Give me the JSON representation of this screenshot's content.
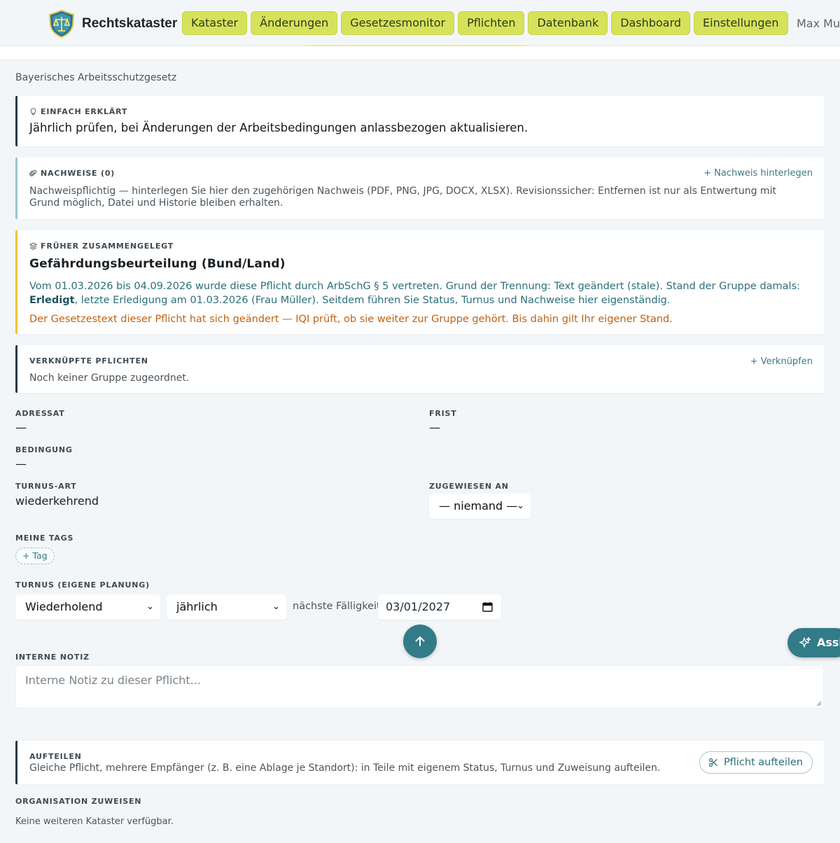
{
  "app": {
    "name": "Rechtskataster",
    "nav": [
      "Kataster",
      "Änderungen",
      "Gesetzesmonitor",
      "Pflichten",
      "Datenbank",
      "Dashboard",
      "Einstellungen"
    ],
    "user": "Max Mus"
  },
  "colors": {
    "accent": "#d6e25a",
    "teal": "#327b88",
    "warning": "#c06212",
    "yellow_border": "#f0c43a"
  },
  "law_title": "Bayerisches Arbeitsschutzgesetz",
  "explained": {
    "label": "EINFACH ERKLÄRT",
    "text": "Jährlich prüfen, bei Änderungen der Arbeitsbedingungen anlassbezogen aktualisieren."
  },
  "nachweise": {
    "label": "NACHWEISE (0)",
    "action": "+ Nachweis hinterlegen",
    "text": "Nachweispflichtig — hinterlegen Sie hier den zugehörigen Nachweis (PDF, PNG, JPG, DOCX, XLSX). Revisionssicher: Entfernen ist nur als Entwertung mit Grund möglich, Datei und Historie bleiben erhalten."
  },
  "frueher": {
    "label": "FRÜHER ZUSAMMENGELEGT",
    "title": "Gefährdungsbeurteilung (Bund/Land)",
    "text_1": "Vom 01.03.2026 bis 04.09.2026 wurde diese Pflicht durch ",
    "link": "ArbSchG § 5",
    "text_2": " vertreten. Grund der Trennung: Text geändert (stale). Stand der Gruppe damals: ",
    "status": "Erledigt",
    "text_3": ", letzte Erledigung am 01.03.2026 (Frau Müller). Seitdem führen Sie Status, Turnus und Nachweise hier eigenständig.",
    "warning": "Der Gesetzestext dieser Pflicht hat sich geändert — IQI prüft, ob sie weiter zur Gruppe gehört. Bis dahin gilt Ihr eigener Stand."
  },
  "verknuepft": {
    "label": "VERKNÜPFTE PFLICHTEN",
    "action": "+ Verknüpfen",
    "text": "Noch keiner Gruppe zugeordnet."
  },
  "fields": {
    "adressat_label": "ADRESSAT",
    "adressat": "—",
    "frist_label": "FRIST",
    "frist": "—",
    "bedingung_label": "BEDINGUNG",
    "bedingung": "—",
    "turnus_art_label": "TURNUS-ART",
    "turnus_art": "wiederkehrend",
    "zugewiesen_label": "ZUGEWIESEN AN",
    "zugewiesen": "— niemand —"
  },
  "tags": {
    "label": "MEINE TAGS",
    "add": "+ Tag"
  },
  "turnus": {
    "label": "TURNUS (EIGENE PLANUNG)",
    "mode": "Wiederholend",
    "interval": "jährlich",
    "due_label": "nächste Fälligkeit",
    "due_date": "03/01/2027"
  },
  "assist_label": "Assi",
  "notiz": {
    "label": "INTERNE NOTIZ",
    "placeholder": "Interne Notiz zu dieser Pflicht..."
  },
  "aufteilen": {
    "label": "AUFTEILEN",
    "text": "Gleiche Pflicht, mehrere Empfänger (z. B. eine Ablage je Standort): in Teile mit eigenem Status, Turnus und Zuweisung aufteilen.",
    "button": "Pflicht aufteilen"
  },
  "organisation": {
    "label": "ORGANISATION ZUWEISEN",
    "text": "Keine weiteren Kataster verfügbar."
  },
  "icons": [
    "logo-shield-icon",
    "bulb-icon",
    "paperclip-icon",
    "layers-icon",
    "chevron-down-icon",
    "calendar-icon",
    "arrow-up-icon",
    "sparkle-icon",
    "scissors-icon"
  ]
}
